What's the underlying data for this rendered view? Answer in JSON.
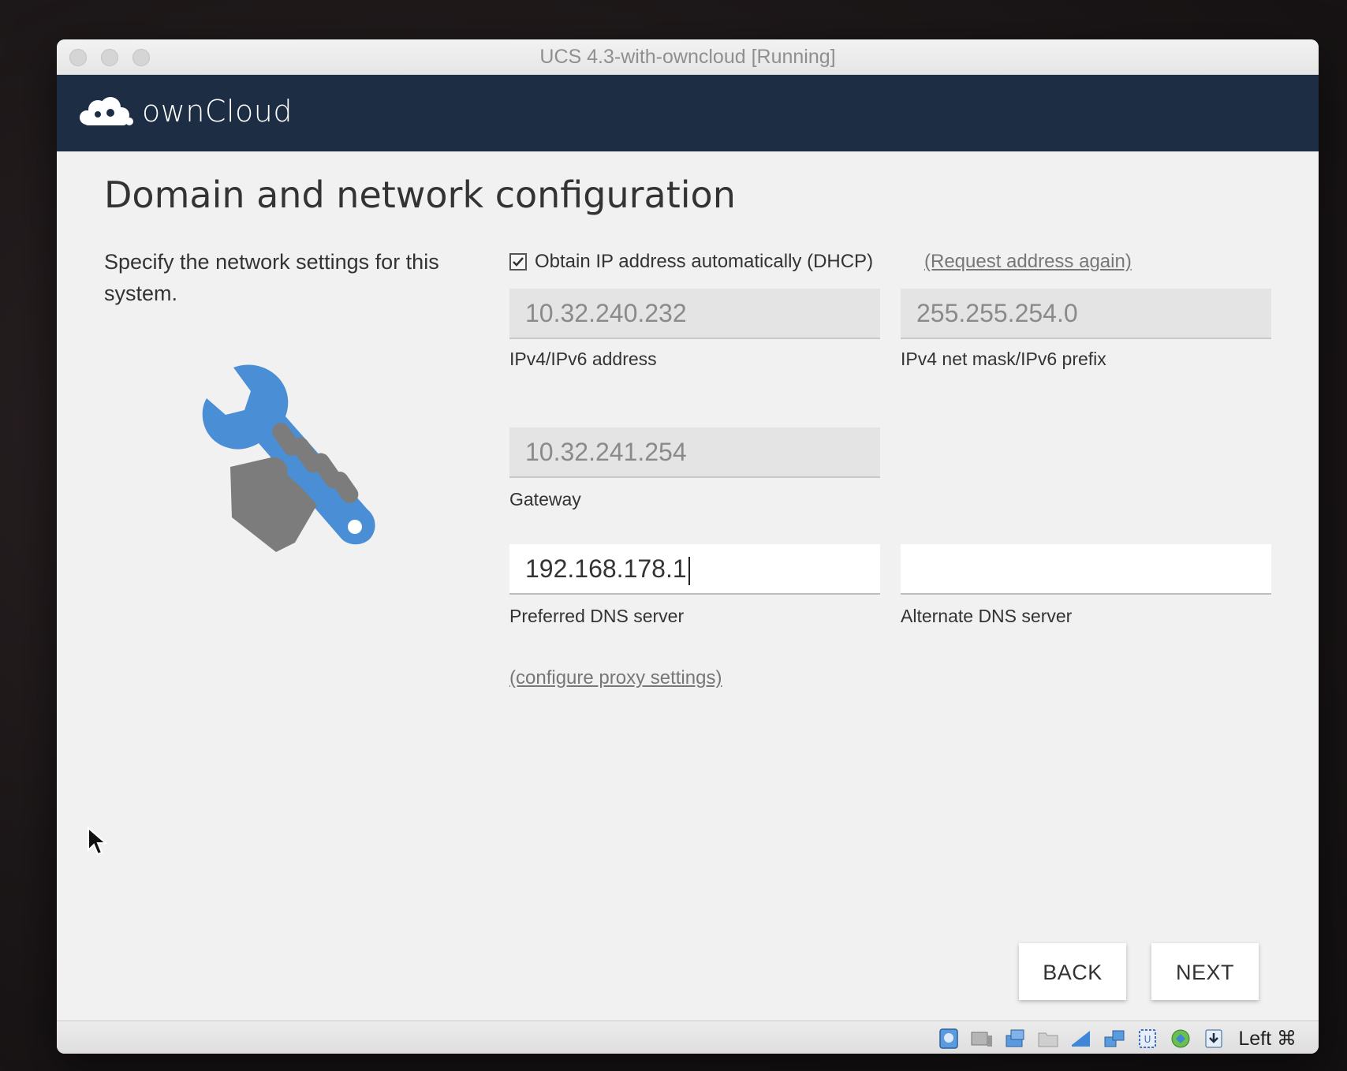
{
  "window": {
    "title": "UCS 4.3-with-owncloud [Running]"
  },
  "header": {
    "brand": "ownCloud"
  },
  "page": {
    "title": "Domain and network configuration",
    "intro": "Specify the network settings for this system."
  },
  "dhcp": {
    "checked": true,
    "label": "Obtain IP address automatically (DHCP)",
    "request_link": "(Request address again)"
  },
  "fields": {
    "ip_address": {
      "value": "10.32.240.232",
      "label": "IPv4/IPv6 address"
    },
    "netmask": {
      "value": "255.255.254.0",
      "label": "IPv4 net mask/IPv6 prefix"
    },
    "gateway": {
      "value": "10.32.241.254",
      "label": "Gateway"
    },
    "preferred_dns": {
      "value": "192.168.178.1",
      "label": "Preferred DNS server"
    },
    "alternate_dns": {
      "value": "",
      "label": "Alternate DNS server"
    }
  },
  "proxy_link": "(configure proxy settings)",
  "buttons": {
    "back": "BACK",
    "next": "NEXT"
  },
  "statusbar": {
    "icons": [
      "hard-disk-icon",
      "optical-drive-icon",
      "usb-icon",
      "shared-folder-icon",
      "display-icon",
      "network-icon",
      "recording-icon",
      "cpu-icon",
      "mouse-integration-icon",
      "download-icon"
    ],
    "host_key": "Left ⌘"
  },
  "colors": {
    "header_bg": "#1d2d44",
    "accent_blue": "#4a8fd6",
    "content_bg": "#f1f1f1"
  }
}
